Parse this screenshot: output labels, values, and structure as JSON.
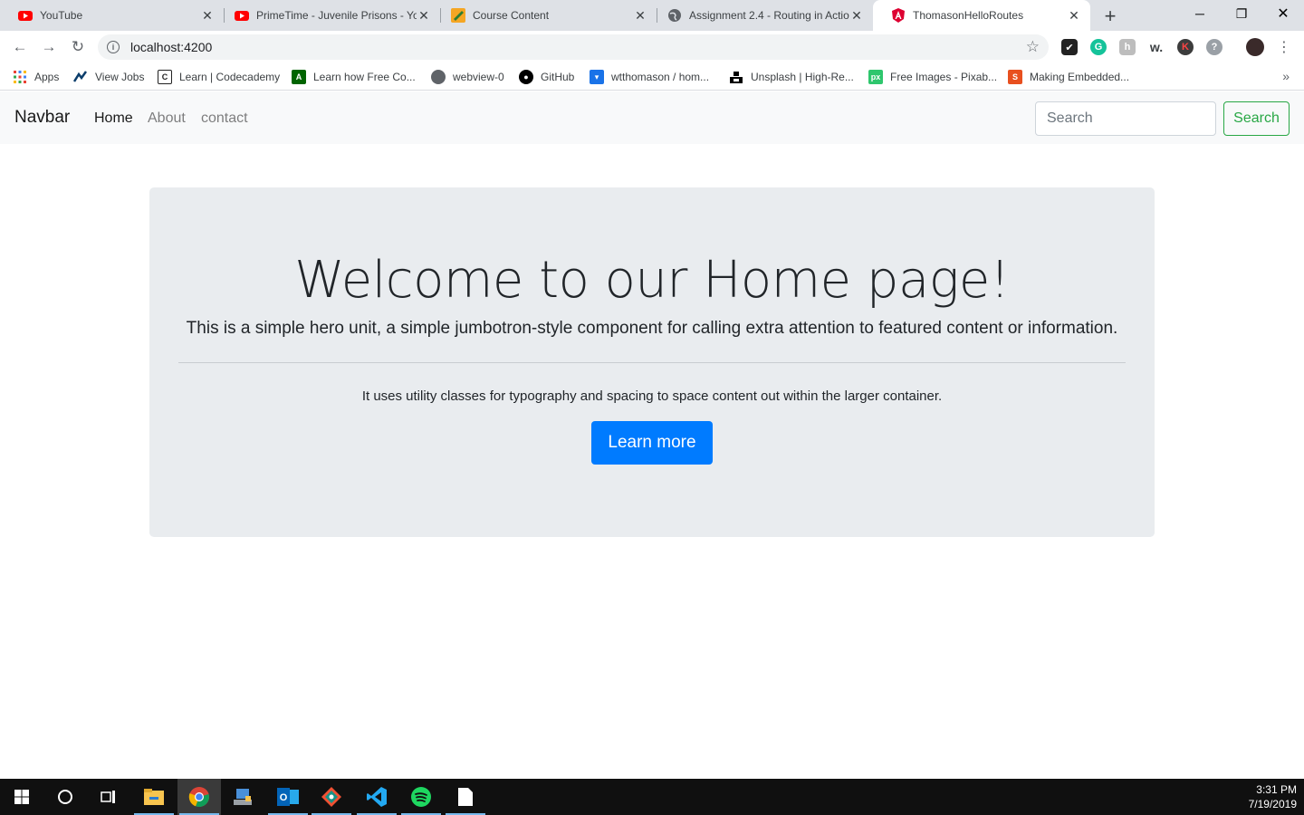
{
  "browser": {
    "tabs": [
      {
        "title": "YouTube",
        "icon": "youtube-icon"
      },
      {
        "title": "PrimeTime - Juvenile Prisons - Yo",
        "icon": "youtube-icon"
      },
      {
        "title": "Course Content",
        "icon": "course-icon"
      },
      {
        "title": "Assignment 2.4 - Routing in Actio",
        "icon": "globe-icon"
      },
      {
        "title": "ThomasonHelloRoutes",
        "icon": "angular-icon"
      }
    ],
    "url": "localhost:4200",
    "bookmarks": [
      {
        "label": "Apps",
        "icon": "apps-grid-icon"
      },
      {
        "label": "View Jobs",
        "icon": "jobs-icon"
      },
      {
        "label": "Learn | Codecademy",
        "icon": "codecademy-icon"
      },
      {
        "label": "Learn how Free Co...",
        "icon": "freecodecamp-icon"
      },
      {
        "label": "webview-0",
        "icon": "globe-icon"
      },
      {
        "label": "GitHub",
        "icon": "github-icon"
      },
      {
        "label": "wtthomason / hom...",
        "icon": "bookmark-shield-icon"
      },
      {
        "label": "Unsplash | High-Re...",
        "icon": "unsplash-icon"
      },
      {
        "label": "Free Images - Pixab...",
        "icon": "px-icon"
      },
      {
        "label": "Making Embedded...",
        "icon": "embedded-icon"
      }
    ]
  },
  "navbar": {
    "brand": "Navbar",
    "links": [
      {
        "label": "Home",
        "active": true
      },
      {
        "label": "About",
        "active": false
      },
      {
        "label": "contact",
        "active": false
      }
    ],
    "search_placeholder": "Search",
    "search_button": "Search"
  },
  "jumbotron": {
    "heading": "Welcome to our Home page!",
    "lead": "This is a simple hero unit, a simple jumbotron-style component for calling extra attention to featured content or information.",
    "body": "It uses utility classes for typography and spacing to space content out within the larger container.",
    "button": "Learn more"
  },
  "taskbar": {
    "time": "3:31 PM",
    "date": "7/19/2019"
  },
  "colors": {
    "primary": "#007bff",
    "success": "#28a745",
    "jumbotron_bg": "#e9ecef",
    "navbar_bg": "#f8f9fa"
  }
}
